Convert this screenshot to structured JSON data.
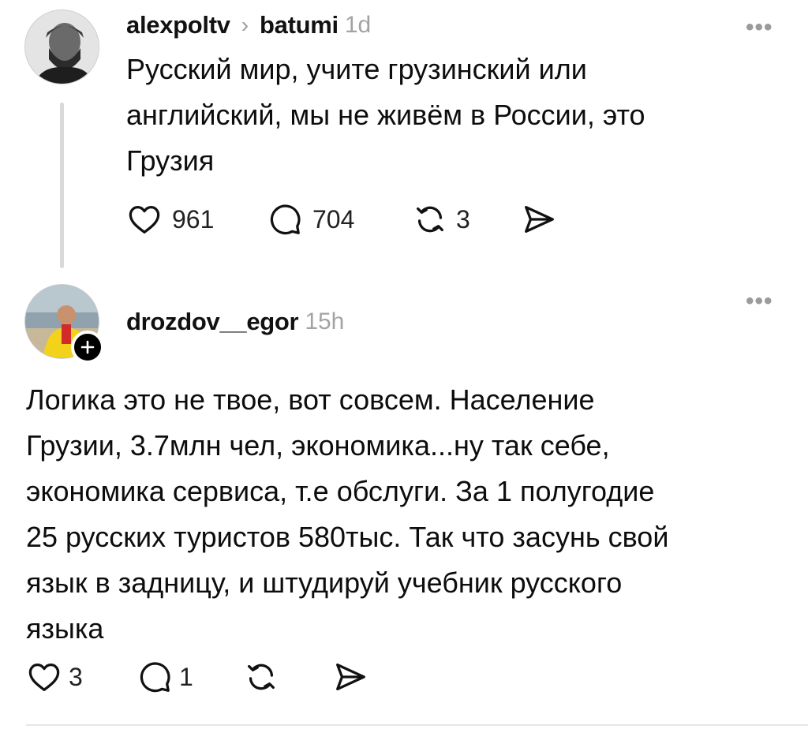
{
  "post1": {
    "author": "alexpoltv",
    "separator": "›",
    "community": "batumi",
    "time": "1d",
    "text_line1": "Русский мир, учите грузинский или",
    "text_line2": "английский, мы не живём в России, это",
    "text_line3": "Грузия",
    "likes": "961",
    "comments": "704",
    "reposts": "3",
    "more": "•••"
  },
  "post2": {
    "author": "drozdov__egor",
    "time": "15h",
    "text_line1": "Логика это не твое, вот совсем. Население",
    "text_line2": "Грузии, 3.7млн чел, экономика...ну так себе,",
    "text_line3": "экономика сервиса, т.е обслуги. За 1 полугодие",
    "text_line4": "25 русских туристов 580тыс. Так что засунь свой",
    "text_line5": "язык в задницу, и штудируй учебник русского",
    "text_line6": "языка",
    "likes": "3",
    "comments": "1",
    "more": "•••"
  },
  "icons": {
    "like": "heart-icon",
    "comment": "comment-bubble-icon",
    "repost": "repost-icon",
    "share": "send-icon",
    "more": "more-options-icon",
    "follow": "plus-icon"
  },
  "colors": {
    "text": "#000000",
    "muted": "#a3a3a3",
    "thread_line": "#d9d9d9",
    "badge": "#000000"
  }
}
